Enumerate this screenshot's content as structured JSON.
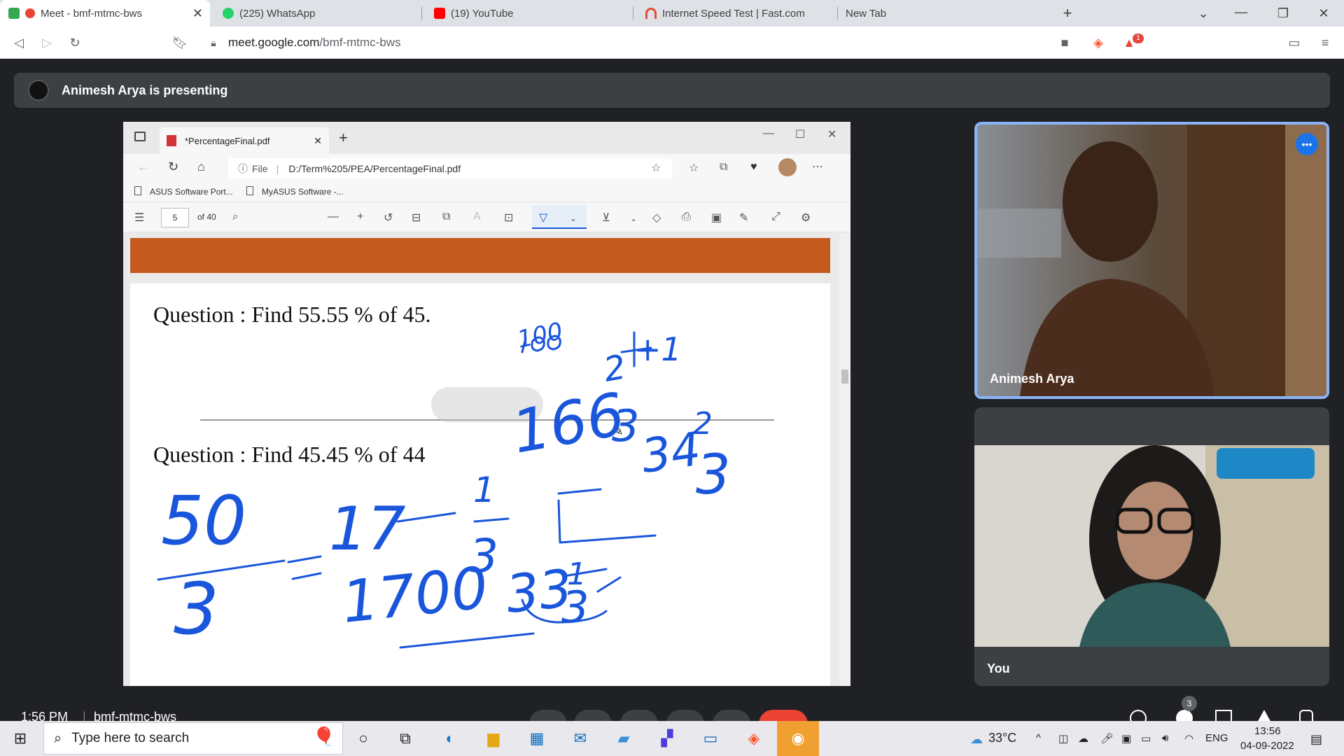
{
  "browser": {
    "tabs": [
      {
        "label": "Meet - bmf-mtmc-bws",
        "color": "#ea4335"
      },
      {
        "label": "(225) WhatsApp",
        "color": "#25d366"
      },
      {
        "label": "(19) YouTube",
        "color": "#ff0000"
      },
      {
        "label": "Internet Speed Test | Fast.com",
        "color": "#e04e39"
      },
      {
        "label": "New Tab",
        "color": ""
      }
    ],
    "url": {
      "host": "meet.google.com",
      "path": "/bmf-mtmc-bws"
    },
    "brave_badge": "1"
  },
  "meet": {
    "presenting_banner": "Animesh Arya is presenting",
    "participants": [
      {
        "name": "Animesh Arya",
        "speaking": true
      },
      {
        "name": "You",
        "speaking": false
      }
    ],
    "footer_time": "1:56 PM",
    "footer_code": "bmf-mtmc-bws",
    "people_count": "3"
  },
  "shared_screen": {
    "tab_title": "*PercentageFinal.pdf",
    "address_label": "File",
    "address": "D:/Term%205/PEA/PercentageFinal.pdf",
    "favorites": [
      "ASUS Software Port...",
      "MyASUS Software -..."
    ],
    "page_number": "5",
    "page_total": "of 40",
    "questions": [
      "Question : Find 55.55 % of 45.",
      "Question : Find 45.45 % of 44"
    ],
    "handwriting": [
      "100",
      "166",
      "2",
      "3",
      "+1",
      "34",
      "2",
      "3",
      "50",
      "3",
      "17",
      "1",
      "3",
      "1700",
      "33",
      "1",
      "3"
    ],
    "accent": "#1a56db"
  },
  "taskbar": {
    "search_placeholder": "Type here to search",
    "weather": "33°C",
    "language": "ENG",
    "time": "13:56",
    "date": "04-09-2022"
  }
}
